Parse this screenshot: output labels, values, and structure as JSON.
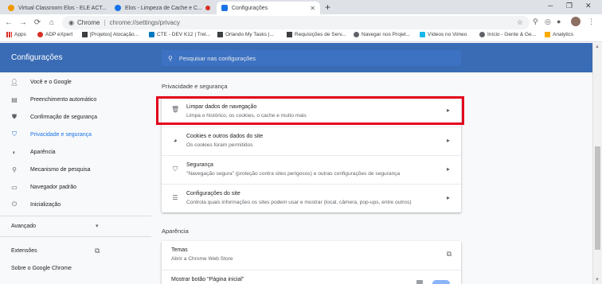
{
  "tabs": [
    {
      "title": "Virtual Classroom Elos - ELE ACT...",
      "favicon_color": "#f29900"
    },
    {
      "title": "Elos - Limpeza de Cache e C...",
      "favicon_color": "#1a73e8",
      "recording": true
    },
    {
      "title": "Configurações",
      "favicon_color": "#1a73e8",
      "active": true
    }
  ],
  "toolbar": {
    "site_label": "Chrome",
    "url": "chrome://settings/privacy"
  },
  "bookmarks": [
    {
      "label": "Apps",
      "icon_color": "#d93025"
    },
    {
      "label": "ADP eXpert",
      "icon_color": "#d93025"
    },
    {
      "label": "[Projetos] Alocação...",
      "icon_color": "#3c4043"
    },
    {
      "label": "CTE - DEV K12 | Trel...",
      "icon_color": "#0079bf"
    },
    {
      "label": "Orlando My Tasks |...",
      "icon_color": "#3c4043"
    },
    {
      "label": "Requisições de Serv...",
      "icon_color": "#3c4043"
    },
    {
      "label": "Navegar nos Projet...",
      "icon_color": "#5f6368"
    },
    {
      "label": "Vídeos no Vimeo",
      "icon_color": "#1ab7ea"
    },
    {
      "label": "Início - Gente & Ge...",
      "icon_color": "#5f6368"
    },
    {
      "label": "Analytics",
      "icon_color": "#f9ab00"
    }
  ],
  "header": {
    "title": "Configurações",
    "search_placeholder": "Pesquisar nas configurações"
  },
  "sidebar": {
    "items": [
      {
        "label": "Você e o Google",
        "icon": "person-icon"
      },
      {
        "label": "Preenchimento automático",
        "icon": "clipboard-icon"
      },
      {
        "label": "Confirmação de segurança",
        "icon": "shield-check-icon"
      },
      {
        "label": "Privacidade e segurança",
        "icon": "shield-icon",
        "selected": true
      },
      {
        "label": "Aparência",
        "icon": "palette-icon"
      },
      {
        "label": "Mecanismo de pesquisa",
        "icon": "search-icon"
      },
      {
        "label": "Navegador padrão",
        "icon": "browser-icon"
      },
      {
        "label": "Inicialização",
        "icon": "power-icon"
      }
    ],
    "advanced": "Avançado",
    "extensions": "Extensões",
    "about": "Sobre o Google Chrome"
  },
  "privacy": {
    "section_title": "Privacidade e segurança",
    "rows": [
      {
        "title": "Limpar dados de navegação",
        "subtitle": "Limpa o histórico, os cookies, o cache e muito mais",
        "icon": "trash-icon"
      },
      {
        "title": "Cookies e outros dados do site",
        "subtitle": "Os cookies foram permitidos",
        "icon": "cookie-icon"
      },
      {
        "title": "Segurança",
        "subtitle": "\"Navegação segura\" (proteção contra sites perigosos) e outras configurações de segurança",
        "icon": "shield-icon"
      },
      {
        "title": "Configurações do site",
        "subtitle": "Controla quais informações os sites podem usar e mostrar (local, câmera, pop-ups, entre outros)",
        "icon": "sliders-icon"
      }
    ]
  },
  "appearance": {
    "section_title": "Aparência",
    "rows": [
      {
        "title": "Temas",
        "subtitle": "Abrir a Chrome Web Store"
      },
      {
        "title": "Mostrar botão \"Página inicial\"",
        "subtitle": ""
      }
    ]
  },
  "colors": {
    "header": "#3a6cb5",
    "accent": "#1a73e8",
    "highlight": "#e3001b"
  }
}
